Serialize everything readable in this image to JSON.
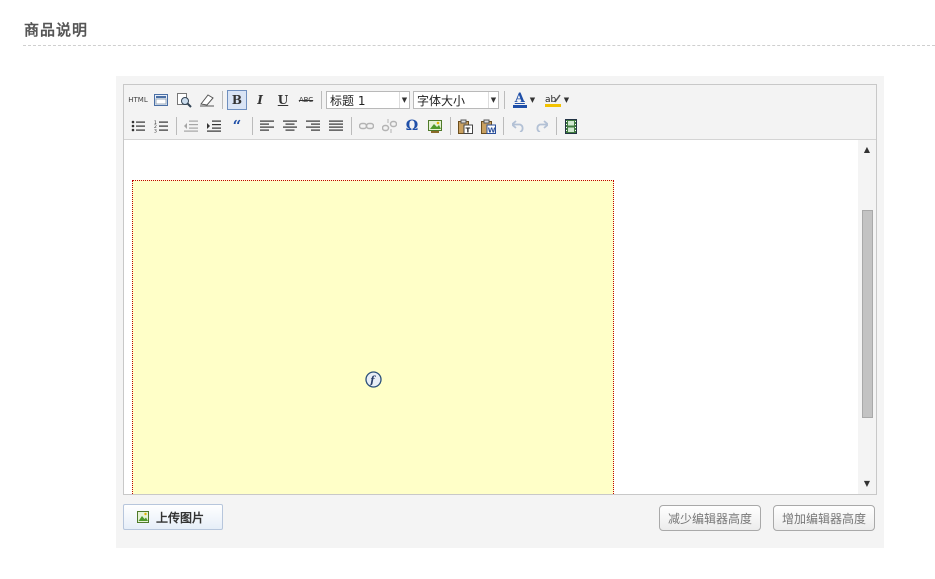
{
  "section": {
    "title": "商品说明"
  },
  "toolbar": {
    "html_label": "HTML",
    "heading_select": "标题 1",
    "fontsize_select": "字体大小",
    "bold_label": "B",
    "italic_label": "I",
    "underline_label": "U",
    "strike_label": "ABC",
    "quote_label": "“",
    "omega_label": "Ω",
    "font_color_label": "A"
  },
  "actions": {
    "upload_label": "上传图片",
    "decrease_label": "减少编辑器高度",
    "increase_label": "增加编辑器高度"
  },
  "colors": {
    "flash_bg": "#ffffc8",
    "flash_border": "#c00000",
    "font_color_bar": "#1f4fa8",
    "highlight_bar": "#f3c200"
  }
}
